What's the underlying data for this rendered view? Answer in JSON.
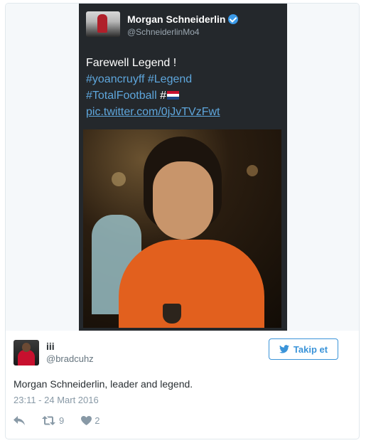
{
  "embedded_tweet": {
    "author_name": "Morgan Schneiderlin",
    "author_handle": "@SchneiderlinMo4",
    "text_line1": "Farewell Legend !",
    "hashtag1": "#yoancruyff",
    "hashtag2": "#Legend",
    "hashtag3": "#TotalFootball",
    "hashtag4": "#",
    "media_link": "pic.twitter.com/0jJvTVzFwt"
  },
  "tweet": {
    "author_name": "iii",
    "author_handle": "@bradcuhz",
    "follow_label": "Takip et",
    "text": "Morgan Schneiderlin, leader and legend.",
    "timestamp": "23:11 - 24 Mart 2016",
    "retweet_count": "9",
    "like_count": "2"
  },
  "colors": {
    "link": "#3b94d9",
    "embed_bg": "#24282c",
    "text": "#292f33",
    "muted": "#8899a6"
  }
}
